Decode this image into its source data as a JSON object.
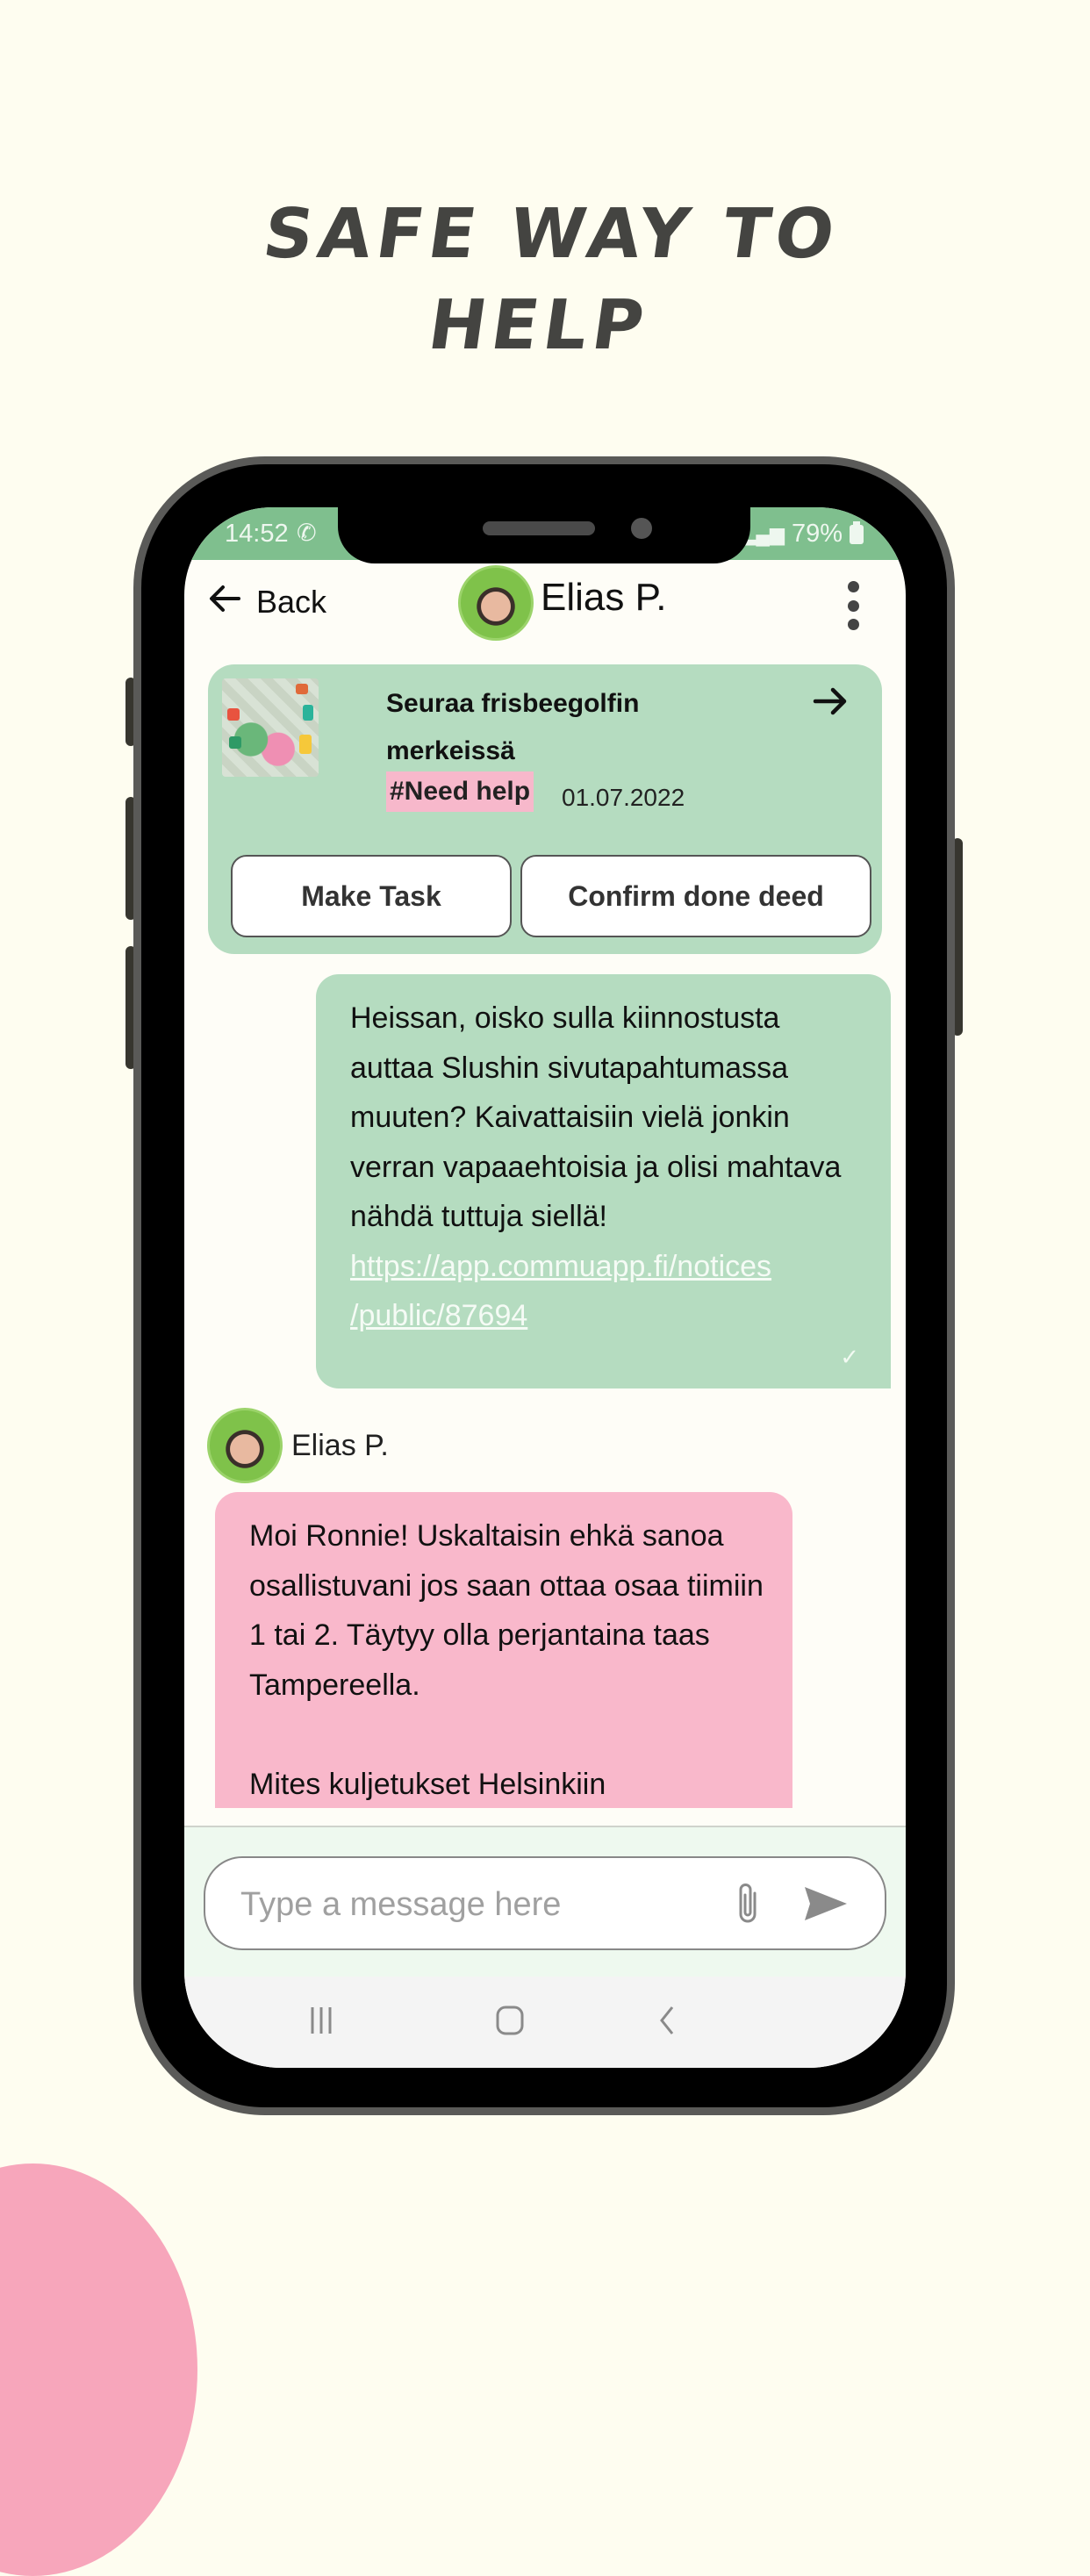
{
  "promo": {
    "headline_line1": "SAFE WAY TO",
    "headline_line2": "HELP"
  },
  "status_bar": {
    "time": "14:52",
    "left_icons": [
      "whatsapp-icon",
      "gallery-icon"
    ],
    "right_icons": [
      "wifi-icon",
      "signal-icon"
    ],
    "battery": "79%"
  },
  "header": {
    "back_label": "Back",
    "contact_name": "Elias P.",
    "more_icon": "more-vertical-icon"
  },
  "task_card": {
    "title": "Seuraa frisbeegolfin merkeissä",
    "tag": "#Need help",
    "date": "01.07.2022",
    "make_task_label": "Make Task",
    "confirm_label": "Confirm done deed"
  },
  "messages": [
    {
      "direction": "sent",
      "text": "Heissan, oisko sulla kiinnostusta auttaa Slushin sivutapahtumassa muuten? Kaivattaisiin vielä jonkin verran vapaaehtoisia ja olisi mahtava nähdä tuttuja siellä!",
      "link_line1": "https://app.commuapp.fi/notices",
      "link_line2": "/public/87694",
      "status": "✓"
    },
    {
      "direction": "received",
      "sender": "Elias P.",
      "para1": "Moi Ronnie! Uskaltaisin ehkä sanoa osallistuvani jos saan ottaa osaa tiimiin 1 tai 2. Täytyy olla perjantaina taas Tampereella.",
      "para2": "Mites kuljetukset Helsinkiin"
    }
  ],
  "composer": {
    "placeholder": "Type a message here",
    "value": ""
  },
  "colors": {
    "background": "#fefdf0",
    "status_bar": "#7fbf8e",
    "sent_bubble": "#b5dcc0",
    "received_bubble": "#f9b8cb",
    "tag": "#f7b8cb",
    "blob": "#f7a6bb"
  }
}
